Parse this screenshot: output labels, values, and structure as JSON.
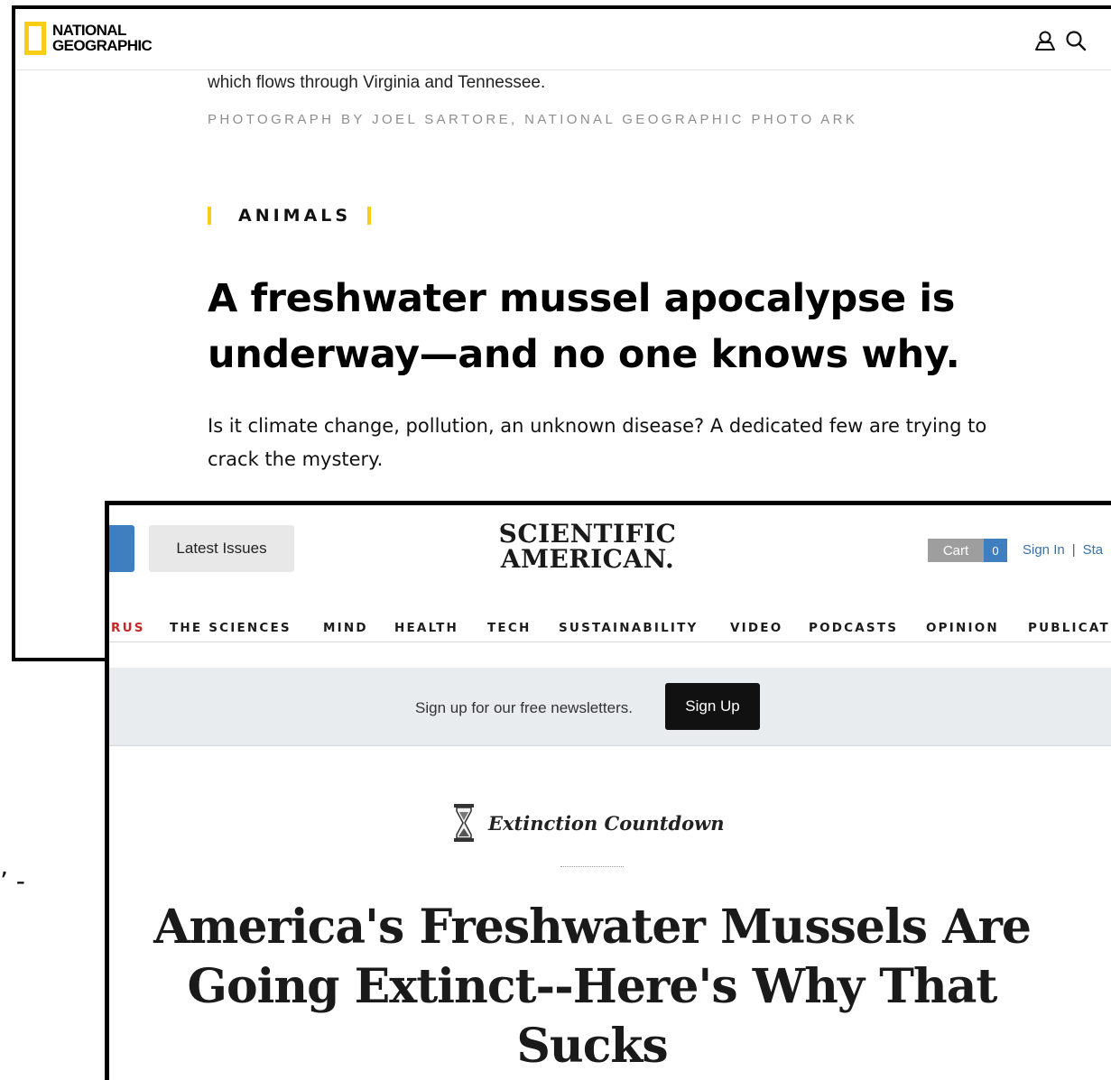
{
  "natgeo": {
    "logo": {
      "line1": "NATIONAL",
      "line2": "GEOGRAPHIC",
      "brand_color": "#f7cd16"
    },
    "header_icons": [
      "user-icon",
      "search-icon"
    ],
    "caption": "which flows through Virginia and Tennessee.",
    "credit": "PHOTOGRAPH BY JOEL SARTORE, NATIONAL GEOGRAPHIC PHOTO ARK",
    "category": "ANIMALS",
    "headline": "A freshwater mussel apocalypse is underway—and no one knows why.",
    "dek": "Is it climate change, pollution, an unknown disease? A dedicated few are trying to crack the mystery."
  },
  "sciam": {
    "latest_issues_label": "Latest Issues",
    "logo": {
      "line1": "SCIENTIFIC",
      "line2": "AMERICAN."
    },
    "cart": {
      "label": "Cart",
      "count": "0"
    },
    "account": {
      "sign_in": "Sign In",
      "separator": "|",
      "next": "Sta"
    },
    "nav": [
      "RUS",
      "THE SCIENCES",
      "MIND",
      "HEALTH",
      "TECH",
      "SUSTAINABILITY",
      "VIDEO",
      "PODCASTS",
      "OPINION",
      "PUBLICAT"
    ],
    "newsletter": {
      "text": "Sign up for our free newsletters.",
      "button": "Sign Up"
    },
    "column": {
      "icon": "hourglass-icon",
      "name": "Extinction Countdown"
    },
    "headline": "America's Freshwater Mussels Are Going Extinct--Here's Why That Sucks",
    "accent_color": "#3f7fc0"
  },
  "stray_mark": "’ -"
}
